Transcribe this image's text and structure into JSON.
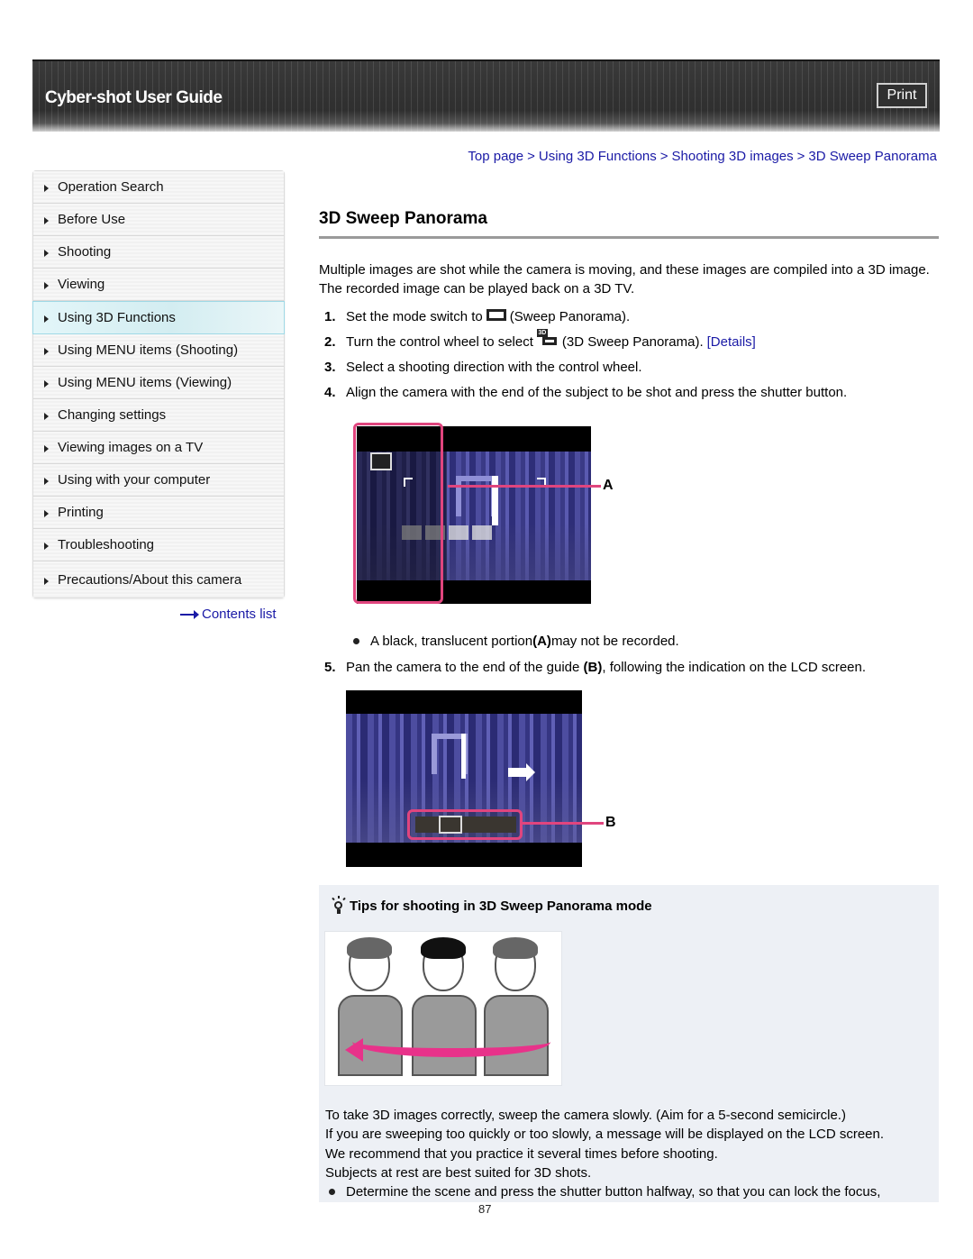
{
  "header": {
    "title": "Cyber-shot User Guide",
    "print_label": "Print"
  },
  "sidebar": {
    "items": [
      {
        "label": "Operation Search",
        "active": false
      },
      {
        "label": "Before Use",
        "active": false
      },
      {
        "label": "Shooting",
        "active": false
      },
      {
        "label": "Viewing",
        "active": false
      },
      {
        "label": "Using 3D Functions",
        "active": true
      },
      {
        "label": "Using MENU items (Shooting)",
        "active": false
      },
      {
        "label": "Using MENU items (Viewing)",
        "active": false
      },
      {
        "label": "Changing settings",
        "active": false
      },
      {
        "label": "Viewing images on a TV",
        "active": false
      },
      {
        "label": "Using with your computer",
        "active": false
      },
      {
        "label": "Printing",
        "active": false
      },
      {
        "label": "Troubleshooting",
        "active": false
      },
      {
        "label": "Precautions/About this camera",
        "active": false
      }
    ],
    "contents_link": "Contents list"
  },
  "breadcrumb": {
    "items": [
      "Top page",
      "Using 3D Functions",
      "Shooting 3D images",
      "3D Sweep Panorama"
    ],
    "separator": ">"
  },
  "main": {
    "title": "3D Sweep Panorama",
    "intro": "Multiple images are shot while the camera is moving, and these images are compiled into a 3D image. The recorded image can be played back on a 3D TV.",
    "steps": [
      {
        "num": "1.",
        "before": "Set the mode switch to",
        "icon": "sweep-panorama-icon",
        "after": "(Sweep Panorama)."
      },
      {
        "num": "2.",
        "before": "Turn the control wheel to select",
        "icon": "3d-sweep-panorama-icon",
        "after": "(3D Sweep Panorama).",
        "link": "[Details]"
      },
      {
        "num": "3.",
        "text": "Select a shooting direction with the control wheel."
      },
      {
        "num": "4.",
        "text": "Align the camera with the end of the subject to be shot and press the shutter button."
      }
    ],
    "figure_a_label": "A",
    "note": {
      "pre": "A black, translucent portion ",
      "bold": "(A)",
      "post": " may not be recorded."
    },
    "step5": {
      "num": "5.",
      "pre": "Pan the camera to the end of the guide ",
      "bold": "(B)",
      "post": ", following the indication on the LCD screen."
    },
    "figure_b_label": "B",
    "icon_3d_text": "3D"
  },
  "tips": {
    "title": "Tips for shooting in 3D Sweep Panorama mode",
    "lines": [
      "To take 3D images correctly, sweep the camera slowly. (Aim for a 5-second semicircle.)",
      "If you are sweeping too quickly or too slowly, a message will be displayed on the LCD screen.",
      "We recommend that you practice it several times before shooting.",
      "Subjects at rest are best suited for 3D shots."
    ],
    "bullet": "Determine the scene and press the shutter button halfway, so that you can lock the focus,"
  },
  "footer": {
    "page_number": "87"
  },
  "colors": {
    "link": "#1a1aa6",
    "highlight_pink": "#e0457e",
    "active_nav": "#d3edf1",
    "tips_bg": "#edf0f5"
  }
}
